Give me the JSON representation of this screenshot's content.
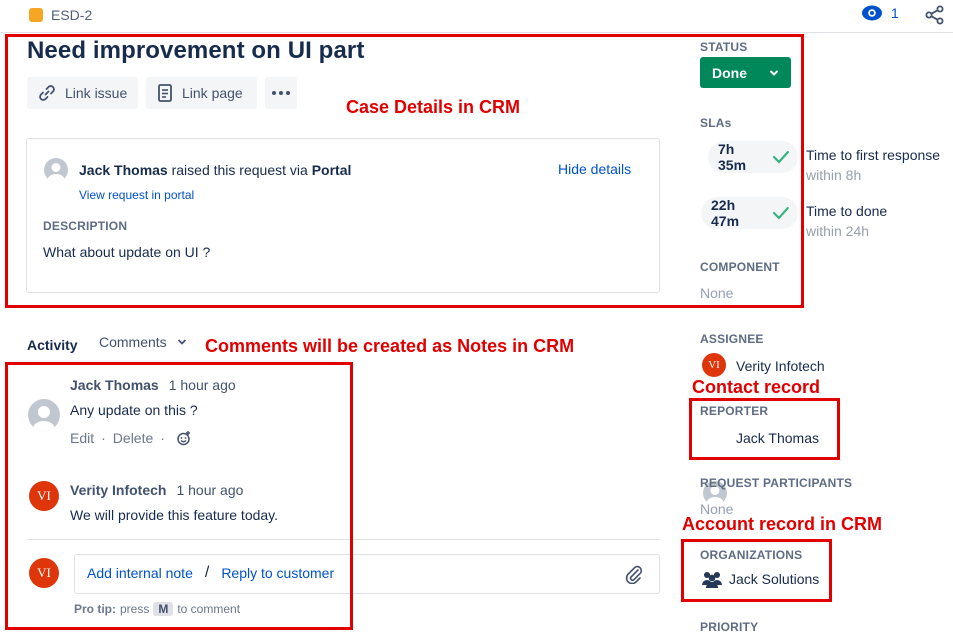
{
  "breadcrumb": {
    "issue_key": "ESD-2"
  },
  "header": {
    "watchers_count": "1"
  },
  "issue": {
    "title": "Need improvement on UI part",
    "link_issue": "Link issue",
    "link_page": "Link page"
  },
  "request": {
    "reporter": "Jack Thomas",
    "raised_text": "raised this request via",
    "channel": "Portal",
    "hide_details": "Hide details",
    "view_in_portal": "View request in portal",
    "description_label": "DESCRIPTION",
    "description": "What about update on UI ?"
  },
  "activity": {
    "label": "Activity",
    "filter": "Comments",
    "comments": [
      {
        "author": "Jack Thomas",
        "time": "1 hour ago",
        "body": "Any update on this ?",
        "edit": "Edit",
        "delete": "Delete"
      },
      {
        "author": "Verity Infotech",
        "initials": "VI",
        "time": "1 hour ago",
        "body": "We will provide this feature today."
      }
    ],
    "add_internal_note": "Add internal note",
    "separator": "/",
    "reply_to_customer": "Reply to customer",
    "protip_label": "Pro tip:",
    "protip_press": "press",
    "protip_key": "M",
    "protip_rest": "to comment"
  },
  "sidebar": {
    "status_label": "STATUS",
    "status_value": "Done",
    "slas_label": "SLAs",
    "slas": [
      {
        "time": "7h 35m",
        "name": "Time to first response",
        "target": "within 8h"
      },
      {
        "time": "22h 47m",
        "name": "Time to done",
        "target": "within 24h"
      }
    ],
    "component_label": "COMPONENT",
    "component_value": "None",
    "assignee_label": "ASSIGNEE",
    "assignee_initials": "VI",
    "assignee_name": "Verity Infotech",
    "reporter_label": "REPORTER",
    "reporter_name": "Jack Thomas",
    "participants_label": "REQUEST PARTICIPANTS",
    "participants_value": "None",
    "organizations_label": "ORGANIZATIONS",
    "organization_name": "Jack Solutions",
    "priority_label": "PRIORITY"
  },
  "annotations": {
    "case_details": "Case Details in CRM",
    "comments_notes": "Comments will be created as Notes in CRM",
    "contact_record": "Contact record",
    "account_record": "Account record in CRM"
  },
  "colors": {
    "annotation": "#e00000",
    "status_done": "#00875a",
    "link": "#0052cc",
    "avatar_vi": "#de350b"
  },
  "icons": [
    "lightbulb-icon",
    "eye-icon",
    "share-icon",
    "link-icon",
    "page-icon",
    "more-icon",
    "chevron-down-icon",
    "check-icon",
    "reaction-icon",
    "attachment-icon",
    "people-icon"
  ]
}
